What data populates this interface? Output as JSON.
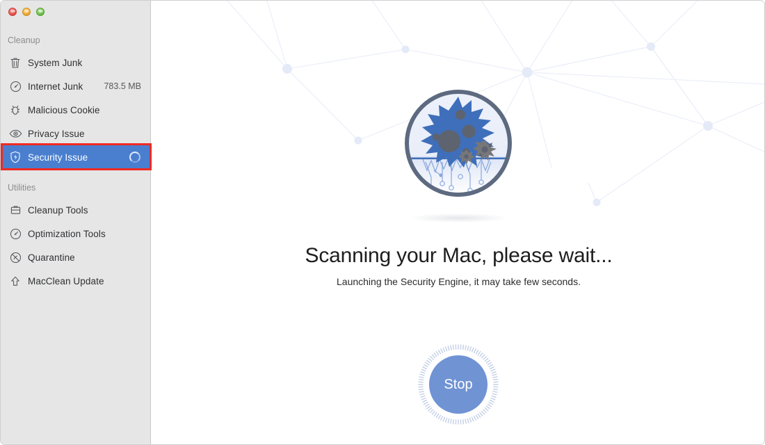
{
  "window": {
    "traffic_lights": [
      "close",
      "minimize",
      "maximize"
    ]
  },
  "sidebar": {
    "sections": [
      {
        "title": "Cleanup",
        "items": [
          {
            "label": "System Junk",
            "icon": "trash-icon",
            "meta": "",
            "selected": false
          },
          {
            "label": "Internet Junk",
            "icon": "gauge-icon",
            "meta": "783.5 MB",
            "selected": false
          },
          {
            "label": "Malicious Cookie",
            "icon": "bug-icon",
            "meta": "",
            "selected": false
          },
          {
            "label": "Privacy Issue",
            "icon": "eye-icon",
            "meta": "",
            "selected": false
          },
          {
            "label": "Security Issue",
            "icon": "shield-bolt-icon",
            "meta": "",
            "selected": true
          }
        ]
      },
      {
        "title": "Utilities",
        "items": [
          {
            "label": "Cleanup Tools",
            "icon": "briefcase-icon",
            "meta": "",
            "selected": false
          },
          {
            "label": "Optimization Tools",
            "icon": "gauge-icon",
            "meta": "",
            "selected": false
          },
          {
            "label": "Quarantine",
            "icon": "no-entry-icon",
            "meta": "",
            "selected": false
          },
          {
            "label": "MacClean Update",
            "icon": "arrow-up-icon",
            "meta": "",
            "selected": false
          }
        ]
      }
    ],
    "selected_spinner": "loading-spinner-icon",
    "annotation_color": "#ef2a21"
  },
  "main": {
    "illustration": "virus-badge-icon",
    "title": "Scanning your Mac, please wait...",
    "subtitle": "Launching the Security Engine, it may take few seconds.",
    "stop_button_label": "Stop"
  },
  "colors": {
    "accent": "#4a7fd0",
    "stop_button": "#7093d4",
    "sidebar_bg": "#e6e6e6",
    "annotation": "#ef2a21",
    "virus_blue": "#3f6fba",
    "virus_gray": "#5a6170"
  }
}
